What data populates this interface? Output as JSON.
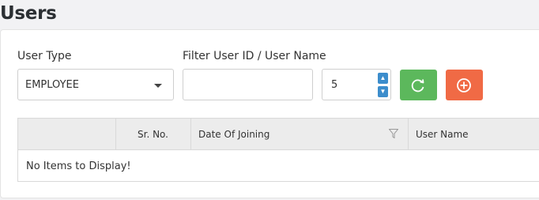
{
  "page": {
    "title": "Users"
  },
  "filters": {
    "user_type_label": "User Type",
    "user_type_value": "EMPLOYEE",
    "filter_label": "Filter User ID / User Name",
    "filter_value": "",
    "page_size_value": "5"
  },
  "grid": {
    "columns": [
      "",
      "Sr. No.",
      "Date Of Joining",
      "User Name"
    ],
    "empty_text": "No Items to Display!"
  },
  "colors": {
    "refresh": "#5cb85c",
    "add": "#f06a45",
    "spinner": "#3c8dcc"
  },
  "icons": {
    "refresh": "refresh-icon",
    "add": "plus-circle-icon",
    "filter": "filter-icon",
    "caret": "caret-down-icon"
  }
}
